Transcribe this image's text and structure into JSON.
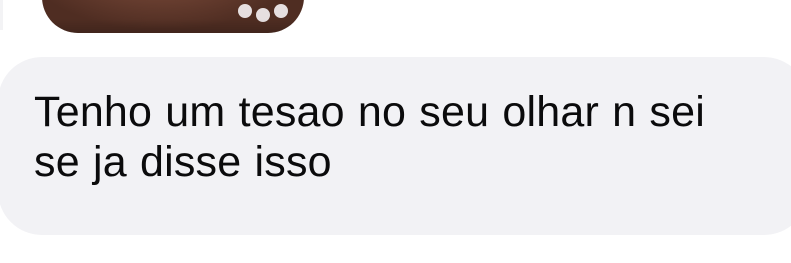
{
  "conversation": {
    "messages": [
      {
        "type": "image",
        "icon": "photo-attachment-icon"
      },
      {
        "type": "text",
        "lines": [
          "Tenho um tesao no seu olhar n sei",
          "se ja disse isso"
        ]
      }
    ]
  },
  "theme": {
    "bubble_color": "#f2f2f5",
    "text_color": "#0b0b0c",
    "background": "#ffffff"
  }
}
